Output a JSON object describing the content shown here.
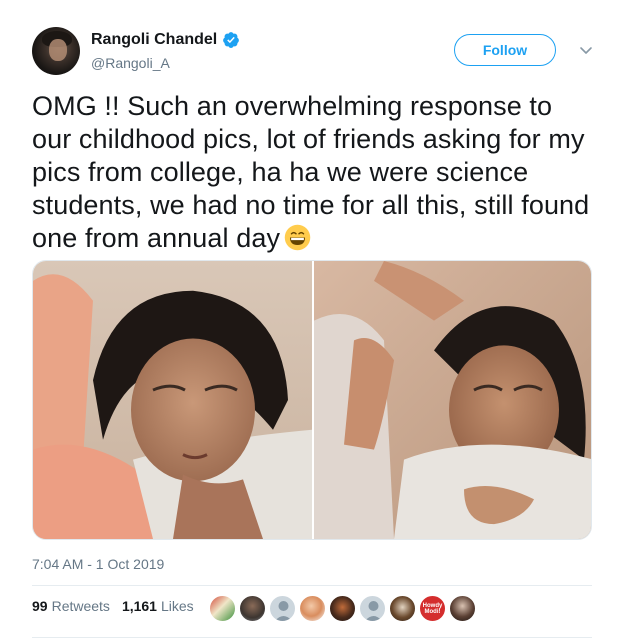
{
  "tweet": {
    "author": {
      "display_name": "Rangoli Chandel",
      "handle": "@Rangoli_A",
      "verified": true
    },
    "follow_label": "Follow",
    "text": "OMG !! Such an overwhelming response to our childhood pics, lot of friends asking for my pics from college, ha ha we were science students, we had no time for all this, still found one from annual day",
    "emoji_icon": "grinning-face-emoji",
    "timestamp": "7:04 AM - 1 Oct 2019",
    "stats": {
      "retweets_count": "99",
      "retweets_label": "Retweets",
      "likes_count": "1,161",
      "likes_label": "Likes"
    },
    "liker_badge_text": "Howdy Modi!"
  },
  "colors": {
    "accent": "#1da1f2",
    "secondary_text": "#657786",
    "primary_text": "#14171a"
  }
}
